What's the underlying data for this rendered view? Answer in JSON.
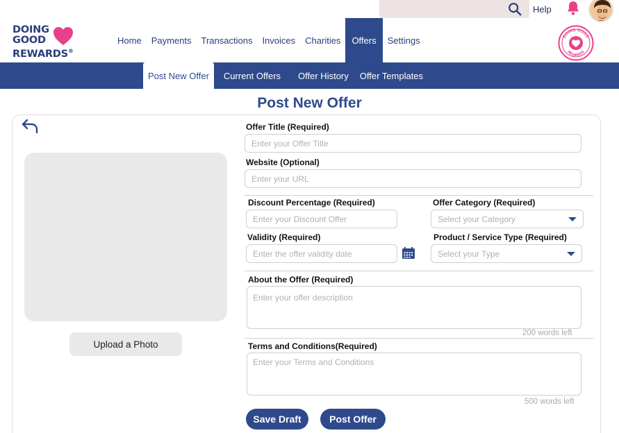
{
  "topbar": {
    "help_label": "Help"
  },
  "brand": {
    "line1": "DOING",
    "line2": "GOOD",
    "line3": "REWARDS",
    "reg": "®",
    "badge_top": "DOING GOOD",
    "badge_bottom": "REWARDS",
    "primary_color": "#2e4a8c",
    "heart_color": "#e8408a"
  },
  "main_nav": {
    "items": [
      {
        "label": "Home"
      },
      {
        "label": "Payments"
      },
      {
        "label": "Transactions"
      },
      {
        "label": "Invoices"
      },
      {
        "label": "Charities"
      },
      {
        "label": "Offers",
        "active": true
      },
      {
        "label": "Settings"
      }
    ]
  },
  "sub_nav": {
    "items": [
      {
        "label": "Post New Offer",
        "active": true
      },
      {
        "label": "Current Offers"
      },
      {
        "label": "Offer History"
      },
      {
        "label": "Offer Templates"
      }
    ]
  },
  "page": {
    "title": "Post New Offer"
  },
  "photo": {
    "upload_label": "Upload a Photo"
  },
  "form": {
    "offer_title": {
      "label": "Offer Title (Required)",
      "placeholder": "Enter your Offer Title"
    },
    "website": {
      "label": "Website (Optional)",
      "placeholder": "Enter your URL"
    },
    "discount": {
      "label": "Discount Percentage (Required)",
      "placeholder": "Enter your Discount Offer"
    },
    "category": {
      "label": "Offer Category (Required)",
      "placeholder": "Select your Category"
    },
    "validity": {
      "label": "Validity (Required)",
      "placeholder": "Enter the offer validity date"
    },
    "product_type": {
      "label": "Product / Service Type (Required)",
      "placeholder": "Select your Type"
    },
    "about": {
      "label": "About the Offer (Required)",
      "placeholder": "Enter your offer description",
      "counter": "200 words left"
    },
    "terms": {
      "label": "Terms and Conditions(Required)",
      "placeholder": "Enter your Terms and Conditions",
      "counter": "500 words left"
    }
  },
  "actions": {
    "save_draft": "Save Draft",
    "post_offer": "Post Offer"
  }
}
